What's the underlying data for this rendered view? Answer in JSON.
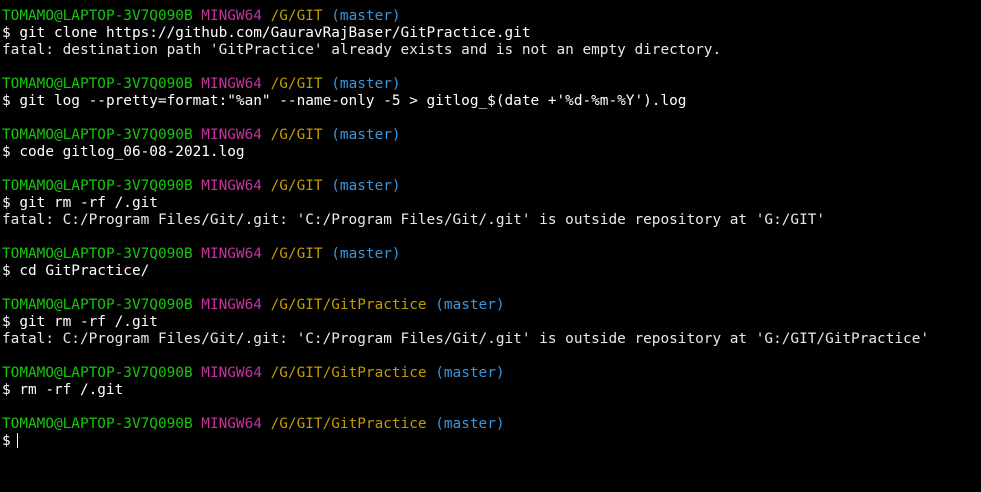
{
  "colors": {
    "background": "#000000",
    "user": "#16c60c",
    "system": "#c4329e",
    "path": "#c19c00",
    "branch": "#3a96dd",
    "text": "#ffffff"
  },
  "blocks": [
    {
      "prompt": {
        "user": "TOMAMO@LAPTOP-3V7Q090B",
        "system": "MINGW64",
        "path": "/G/GIT",
        "branch": "(master)"
      },
      "command": "$ git clone https://github.com/GauravRajBaser/GitPractice.git",
      "output": "fatal: destination path 'GitPractice' already exists and is not an empty directory."
    },
    {
      "prompt": {
        "user": "TOMAMO@LAPTOP-3V7Q090B",
        "system": "MINGW64",
        "path": "/G/GIT",
        "branch": "(master)"
      },
      "command": "$ git log --pretty=format:\"%an\" --name-only -5 > gitlog_$(date +'%d-%m-%Y').log",
      "output": ""
    },
    {
      "prompt": {
        "user": "TOMAMO@LAPTOP-3V7Q090B",
        "system": "MINGW64",
        "path": "/G/GIT",
        "branch": "(master)"
      },
      "command": "$ code gitlog_06-08-2021.log",
      "output": ""
    },
    {
      "prompt": {
        "user": "TOMAMO@LAPTOP-3V7Q090B",
        "system": "MINGW64",
        "path": "/G/GIT",
        "branch": "(master)"
      },
      "command": "$ git rm -rf /.git",
      "output": "fatal: C:/Program Files/Git/.git: 'C:/Program Files/Git/.git' is outside repository at 'G:/GIT'"
    },
    {
      "prompt": {
        "user": "TOMAMO@LAPTOP-3V7Q090B",
        "system": "MINGW64",
        "path": "/G/GIT",
        "branch": "(master)"
      },
      "command": "$ cd GitPractice/",
      "output": ""
    },
    {
      "prompt": {
        "user": "TOMAMO@LAPTOP-3V7Q090B",
        "system": "MINGW64",
        "path": "/G/GIT/GitPractice",
        "branch": "(master)"
      },
      "command": "$ git rm -rf /.git",
      "output": "fatal: C:/Program Files/Git/.git: 'C:/Program Files/Git/.git' is outside repository at 'G:/GIT/GitPractice'"
    },
    {
      "prompt": {
        "user": "TOMAMO@LAPTOP-3V7Q090B",
        "system": "MINGW64",
        "path": "/G/GIT/GitPractice",
        "branch": "(master)"
      },
      "command": "$ rm -rf /.git",
      "output": ""
    }
  ],
  "current": {
    "prompt": {
      "user": "TOMAMO@LAPTOP-3V7Q090B",
      "system": "MINGW64",
      "path": "/G/GIT/GitPractice",
      "branch": "(master)"
    },
    "input": "$"
  }
}
